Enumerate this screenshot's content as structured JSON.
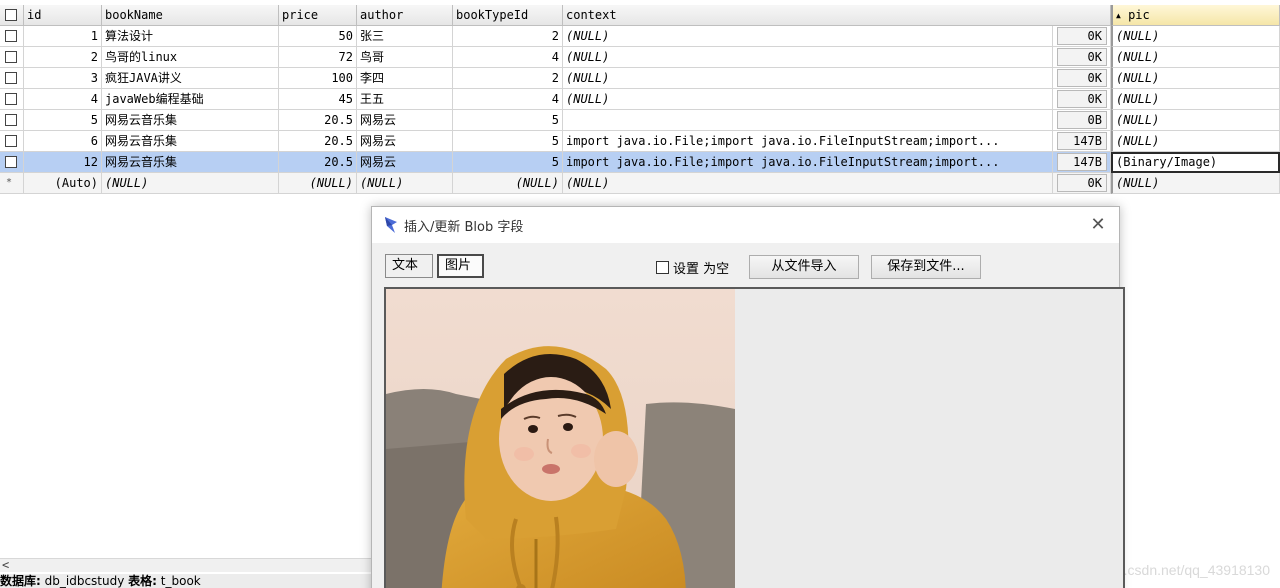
{
  "table": {
    "columns": {
      "id": "id",
      "bookName": "bookName",
      "price": "price",
      "author": "author",
      "bookTypeId": "bookTypeId",
      "context": "context",
      "pic": "pic",
      "pic_sort_indicator": "▲"
    },
    "rows": [
      {
        "id": "1",
        "bookName": "算法设计",
        "price": "50",
        "author": "张三",
        "bookTypeId": "2",
        "context": "(NULL)",
        "size": "0K",
        "pic": "(NULL)"
      },
      {
        "id": "2",
        "bookName": "鸟哥的linux",
        "price": "72",
        "author": "鸟哥",
        "bookTypeId": "4",
        "context": "(NULL)",
        "size": "0K",
        "pic": "(NULL)"
      },
      {
        "id": "3",
        "bookName": "疯狂JAVA讲义",
        "price": "100",
        "author": "李四",
        "bookTypeId": "2",
        "context": "(NULL)",
        "size": "0K",
        "pic": "(NULL)"
      },
      {
        "id": "4",
        "bookName": "javaWeb编程基础",
        "price": "45",
        "author": "王五",
        "bookTypeId": "4",
        "context": "(NULL)",
        "size": "0K",
        "pic": "(NULL)"
      },
      {
        "id": "5",
        "bookName": "网易云音乐集",
        "price": "20.5",
        "author": "网易云",
        "bookTypeId": "5",
        "context": "",
        "size": "0B",
        "pic": "(NULL)"
      },
      {
        "id": "6",
        "bookName": "网易云音乐集",
        "price": "20.5",
        "author": "网易云",
        "bookTypeId": "5",
        "context": "import java.io.File;import java.io.FileInputStream;import...",
        "size": "147B",
        "pic": "(NULL)"
      },
      {
        "id": "12",
        "bookName": "网易云音乐集",
        "price": "20.5",
        "author": "网易云",
        "bookTypeId": "5",
        "context": "import java.io.File;import java.io.FileInputStream;import...",
        "size": "147B",
        "pic": "(Binary/Image)"
      }
    ],
    "new_row": {
      "marker": "*",
      "id": "(Auto)",
      "bookName": "(NULL)",
      "price": "(NULL)",
      "author": "(NULL)",
      "bookTypeId": "(NULL)",
      "context": "(NULL)",
      "size": "0K",
      "pic": "(NULL)"
    }
  },
  "dialog": {
    "title": "插入/更新 Blob 字段",
    "close_glyph": "✕",
    "tab_text": "文本",
    "tab_image": "图片",
    "set_null_label": "设置 为空",
    "import_button": "从文件导入",
    "save_button": "保存到文件..."
  },
  "status": {
    "db_label": "数据库:",
    "db_value": "db_idbcstudy",
    "table_label": "表格:",
    "table_value": "t_book"
  },
  "watermark": "https://blog.csdn.net/qq_43918130",
  "colors": {
    "selected_row": "#b7cff3",
    "header": "#e6e6e6",
    "sorted_header": "#f5e6a8",
    "hoodie": "#d9a23a"
  }
}
